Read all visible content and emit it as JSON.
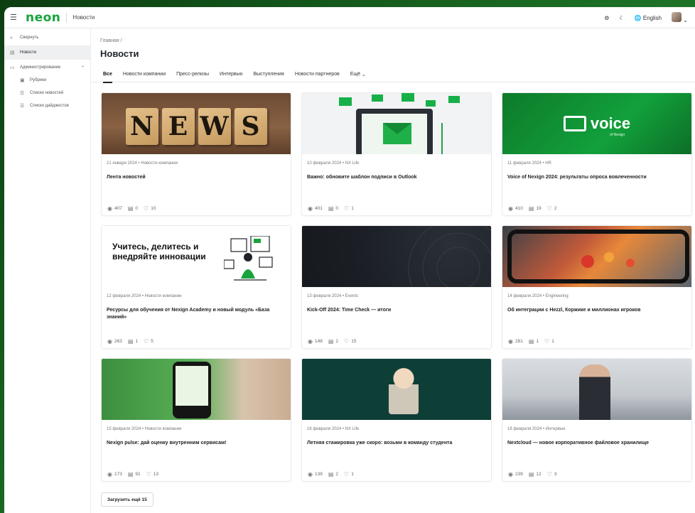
{
  "app": {
    "logo": "neon",
    "section": "Новости"
  },
  "topbar": {
    "language": "English"
  },
  "sidebar": {
    "collapse_label": "Свернуть",
    "items": [
      {
        "label": "Новости",
        "active": true
      },
      {
        "label": "Администрирование"
      },
      {
        "label": "Рубрики"
      },
      {
        "label": "Списки новостей"
      },
      {
        "label": "Списки дайджестов"
      }
    ]
  },
  "breadcrumb": "Главная  /",
  "page_title": "Новости",
  "tabs": [
    {
      "label": "Все",
      "active": true
    },
    {
      "label": "Новости компании"
    },
    {
      "label": "Пресс-релизы"
    },
    {
      "label": "Интервью"
    },
    {
      "label": "Выступления"
    },
    {
      "label": "Новости партнеров"
    },
    {
      "label": "Ещё"
    }
  ],
  "cards": [
    {
      "meta": "21 января 2024 • Новости компании",
      "title": "Лента новостей",
      "views": "407",
      "comments": "0",
      "likes": "10",
      "thumb_letters": "NEWS"
    },
    {
      "meta": "10 февраля 2024 • NX Life",
      "title": "Важно: обновите шаблон подписи в Outlook",
      "views": "401",
      "comments": "0",
      "likes": "1"
    },
    {
      "meta": "11 февраля 2024 • HR",
      "title": "Voice of Nexign 2024: результаты опроса вовлеченности",
      "views": "410",
      "comments": "19",
      "likes": "2",
      "logo_word": "voice",
      "logo_sub": "of Nexign"
    },
    {
      "meta": "12 февраля 2024 • Новости компании",
      "title": "Ресурсы для обучения от Nexign Academy и новый модуль «База знаний»",
      "views": "263",
      "comments": "1",
      "likes": "5",
      "thumb_text": "Учитесь, делитесь и внедряйте инновации"
    },
    {
      "meta": "13 февраля 2024 • Events",
      "title": "Kick-Off 2024: Time Check — итоги",
      "views": "148",
      "comments": "2",
      "likes": "15"
    },
    {
      "meta": "14 февраля 2024 • Engineering",
      "title": "Об интеграции с Hezzl, Коржике и миллионах игроков",
      "views": "281",
      "comments": "1",
      "likes": "1"
    },
    {
      "meta": "15 февраля 2024 • Новости компании",
      "title": "Nexign pulse: дай оценку внутренним сервисам!",
      "views": "173",
      "comments": "91",
      "likes": "13"
    },
    {
      "meta": "16 февраля 2024 • NX Life",
      "title": "Летняя стажировка уже скоро: возьми в команду студента",
      "views": "139",
      "comments": "2",
      "likes": "1"
    },
    {
      "meta": "18 февраля 2024 • Интервью",
      "title": "Nextcloud — новое корпоративное файловое хранилище",
      "views": "239",
      "comments": "12",
      "likes": "3"
    }
  ],
  "load_more": "Загрузить ещё 15",
  "colors": {
    "brand": "#18a33c",
    "background": "#1a6a22"
  }
}
